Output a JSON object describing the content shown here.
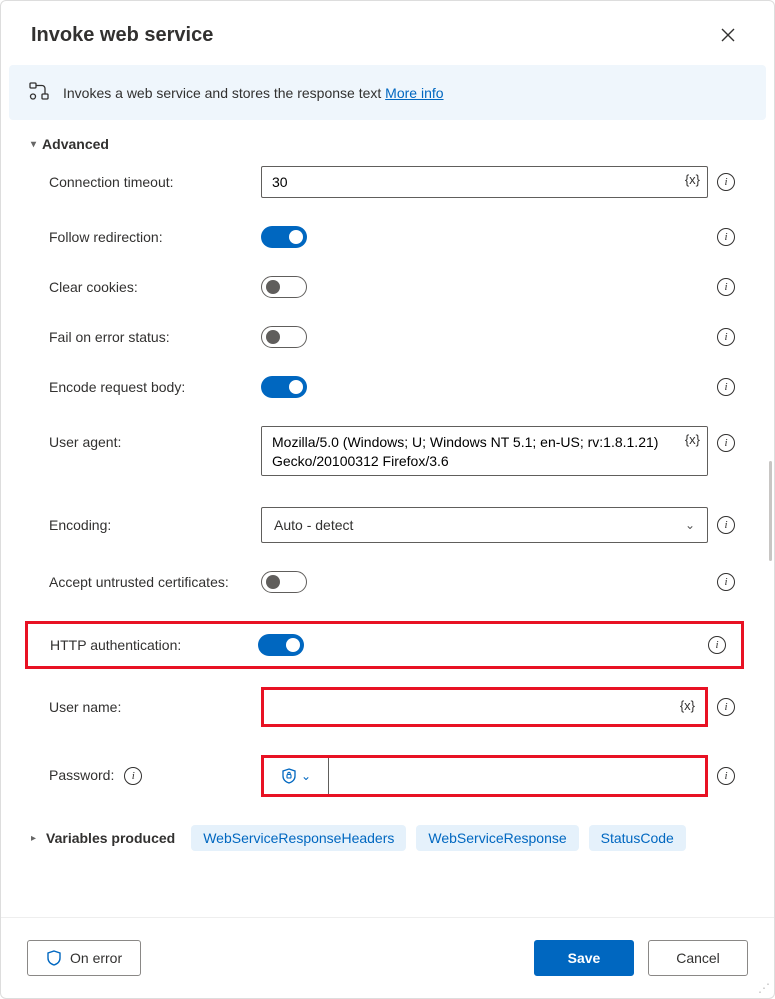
{
  "dialog": {
    "title": "Invoke web service",
    "banner_text": "Invokes a web service and stores the response text ",
    "banner_link": "More info"
  },
  "section": {
    "advanced": "Advanced"
  },
  "fields": {
    "connection_timeout": {
      "label": "Connection timeout:",
      "value": "30"
    },
    "follow_redirection": {
      "label": "Follow redirection:",
      "on": true
    },
    "clear_cookies": {
      "label": "Clear cookies:",
      "on": false
    },
    "fail_on_error": {
      "label": "Fail on error status:",
      "on": false
    },
    "encode_body": {
      "label": "Encode request body:",
      "on": true
    },
    "user_agent": {
      "label": "User agent:",
      "value": "Mozilla/5.0 (Windows; U; Windows NT 5.1; en-US; rv:1.8.1.21) Gecko/20100312 Firefox/3.6"
    },
    "encoding": {
      "label": "Encoding:",
      "value": "Auto - detect"
    },
    "accept_untrusted": {
      "label": "Accept untrusted certificates:",
      "on": false
    },
    "http_auth": {
      "label": "HTTP authentication:",
      "on": true
    },
    "username": {
      "label": "User name:",
      "value": ""
    },
    "password": {
      "label": "Password:",
      "value": ""
    }
  },
  "variables": {
    "label": "Variables produced",
    "chips": [
      "WebServiceResponseHeaders",
      "WebServiceResponse",
      "StatusCode"
    ]
  },
  "footer": {
    "on_error": "On error",
    "save": "Save",
    "cancel": "Cancel"
  },
  "glyph": {
    "var": "{x}"
  }
}
